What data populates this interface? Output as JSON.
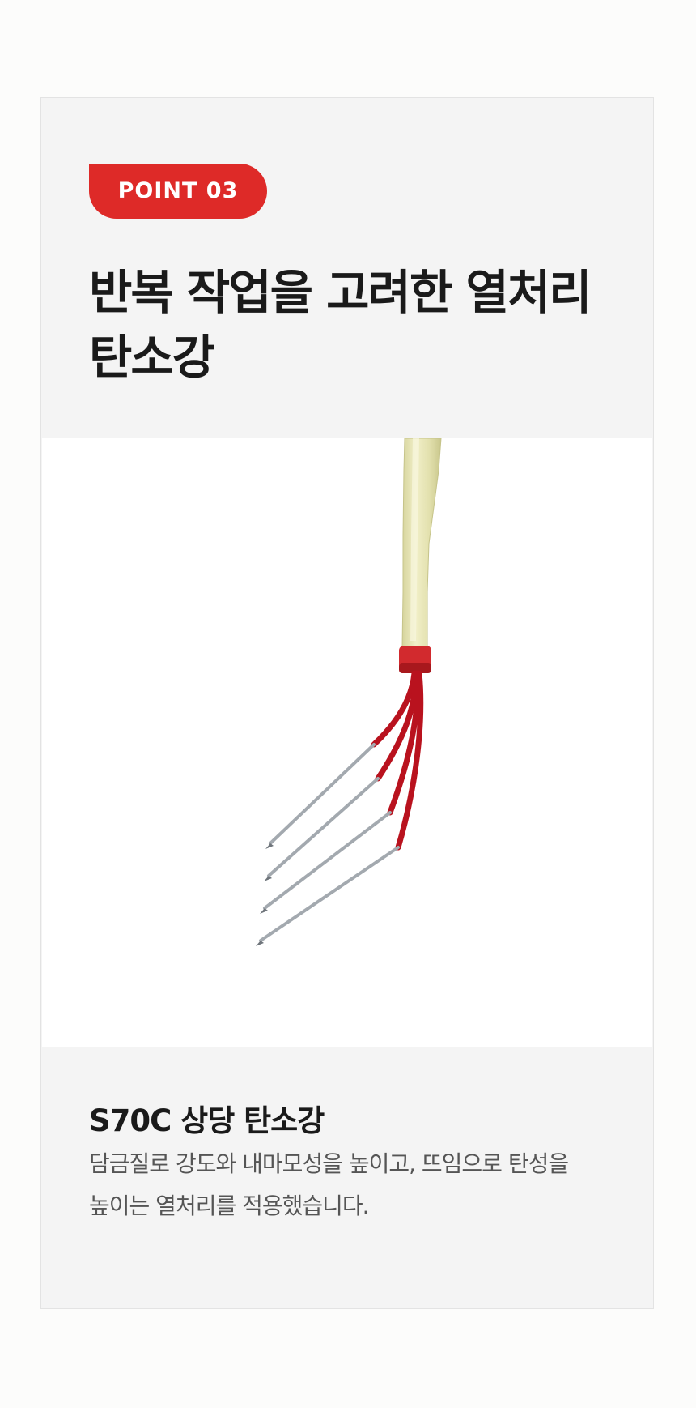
{
  "badge": {
    "label": "POINT 03"
  },
  "title": {
    "line1": "반복 작업을 고려한 열처리",
    "line2": "탄소강"
  },
  "product_image": {
    "icon": "rake-tines-illustration",
    "handle_color": "#e4e2b0",
    "ferrule_color": "#d22a2e",
    "tine_color": "#b9121e",
    "steel_color": "#9aa0a6"
  },
  "feature": {
    "title": "S70C 상당 탄소강",
    "desc_line1": "담금질로 강도와 내마모성을 높이고, 뜨임으로 탄성을",
    "desc_line2": "높이는 열처리를 적용했습니다."
  },
  "colors": {
    "accent": "#de2a28",
    "card_bg": "#f4f4f4",
    "page_bg": "#fcfcfb"
  }
}
